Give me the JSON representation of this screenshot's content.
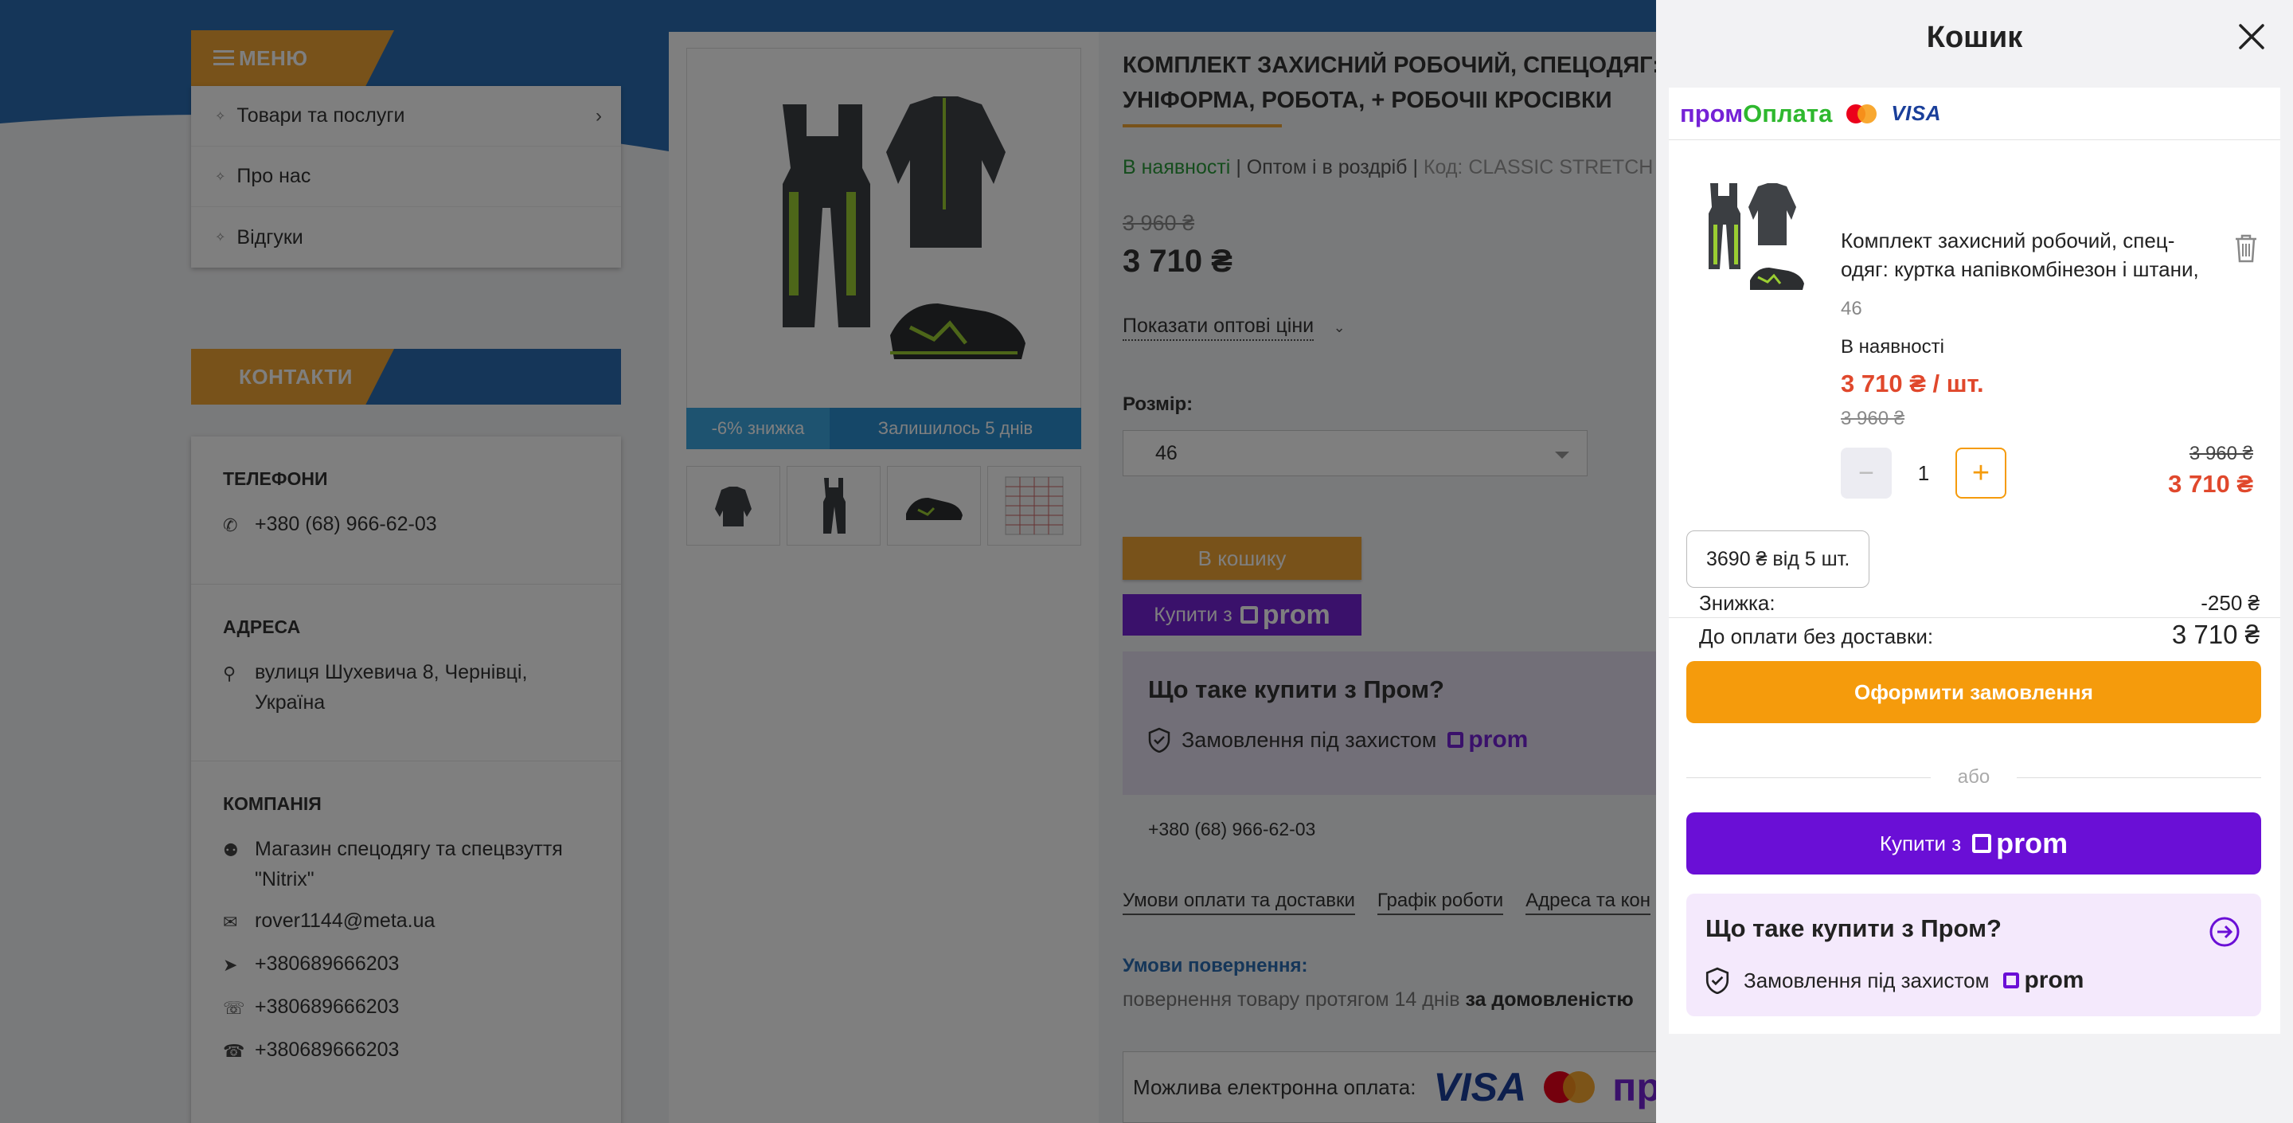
{
  "sidebar": {
    "menu_title": "МЕНЮ",
    "menu_items": [
      {
        "label": "Товари та послуги"
      },
      {
        "label": "Про нас"
      },
      {
        "label": "Відгуки"
      }
    ],
    "contacts_title": "КОНТАКТИ",
    "phones_title": "ТЕЛЕФОНИ",
    "phone": "+380 (68) 966-62-03",
    "address_title": "АДРЕСА",
    "address": "вулиця Шухевича 8, Чернівці, Україна",
    "company_title": "КОМПАНІЯ",
    "company_name": "Магазин спецодягу та спецвзуття \"Nitrix\"",
    "email": "rover1144@meta.ua",
    "telegram": "+380689666203",
    "viber": "+380689666203",
    "whatsapp": "+380689666203"
  },
  "product": {
    "title_line1": "КОМПЛЕКТ ЗАХИСНИЙ РОБОЧИЙ, СПЕЦОДЯГ: КУРТКА",
    "title_line2": "УНІФОРМА, РОБОТА, + РОБОЧІІ КРОСІВКИ",
    "in_stock": "В наявності",
    "wholesale_retail": "Оптом і в роздріб",
    "code": "Код: CLASSIC STRETCH",
    "old_price": "3 960 ₴",
    "price": "3 710 ₴",
    "show_wholesale": "Показати оптові ціни",
    "size_label": "Розмір:",
    "size_value": "46",
    "discount_badge": "-6% знижка",
    "days_left": "Залишилось 5 днів",
    "add_to_cart": "В кошику",
    "buy_with": "Купити з",
    "what_is_title": "Що таке купити з Пром?",
    "protected_order": "Замовлення під захистом",
    "phone": "+380 (68) 966-62-03",
    "links": [
      "Умови оплати та доставки",
      "Графік роботи",
      "Адреса та кон"
    ],
    "returns_title": "Умови повернення:",
    "returns_text": "повернення товару протягом 14 днів",
    "returns_bold": "за домовленістю",
    "epay_label": "Можлива електронна оплата:",
    "epay_visa": "VISA",
    "epay_prom": "пр"
  },
  "brand": {
    "prom": "prom",
    "prompay_1": "пром",
    "prompay_2": "Оплата",
    "visa": "VISA"
  },
  "cart": {
    "title": "Кошик",
    "item": {
      "name": "Комплект захисний робочий, спец-одяг: куртка напівкомбінезон і штани,",
      "size": "46",
      "stock": "В наявності",
      "price_per_unit": "3 710 ₴ / шт.",
      "old_price": "3 960 ₴",
      "quantity": "1",
      "minus": "−",
      "plus": "+",
      "total_old": "3 960 ₴",
      "total_new": "3 710 ₴",
      "bulk_offer": "3690 ₴ від 5 шт."
    },
    "discount_label": "Знижка:",
    "discount_value": "-250 ₴",
    "to_pay_label": "До оплати без доставки:",
    "to_pay_value": "3 710 ₴",
    "checkout": "Оформити замовлення",
    "or": "або",
    "buy_with": "Купити з",
    "what_is_title": "Що таке купити з Пром?",
    "protected_order": "Замовлення під захистом"
  },
  "colors": {
    "accent_orange": "#f59b0c",
    "prom_purple": "#6a0fd6",
    "price_red": "#e0482c",
    "site_blue": "#2a6db3",
    "stock_green": "#2a9a3a"
  }
}
